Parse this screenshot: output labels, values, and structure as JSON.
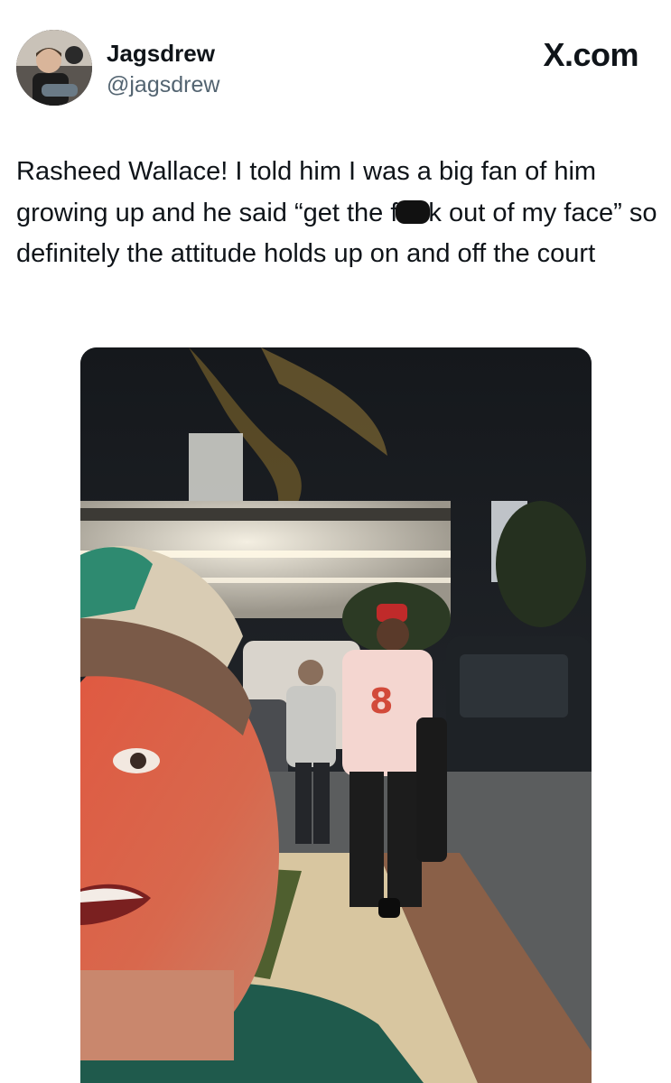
{
  "header": {
    "display_name": "Jagsdrew",
    "handle": "@jagsdrew",
    "brand": "X.com"
  },
  "tweet": {
    "text_before_redaction": "Rasheed Wallace! I told him I was a big fan of him growing up and he said “get the f",
    "text_after_redaction": "k out of my face” so definitely the attitude holds up on and off the court"
  },
  "media": {
    "description_icon": "photo-icon",
    "jersey_number": "8"
  },
  "colors": {
    "text_primary": "#0f1419",
    "text_secondary": "#536471",
    "background": "#ffffff"
  }
}
